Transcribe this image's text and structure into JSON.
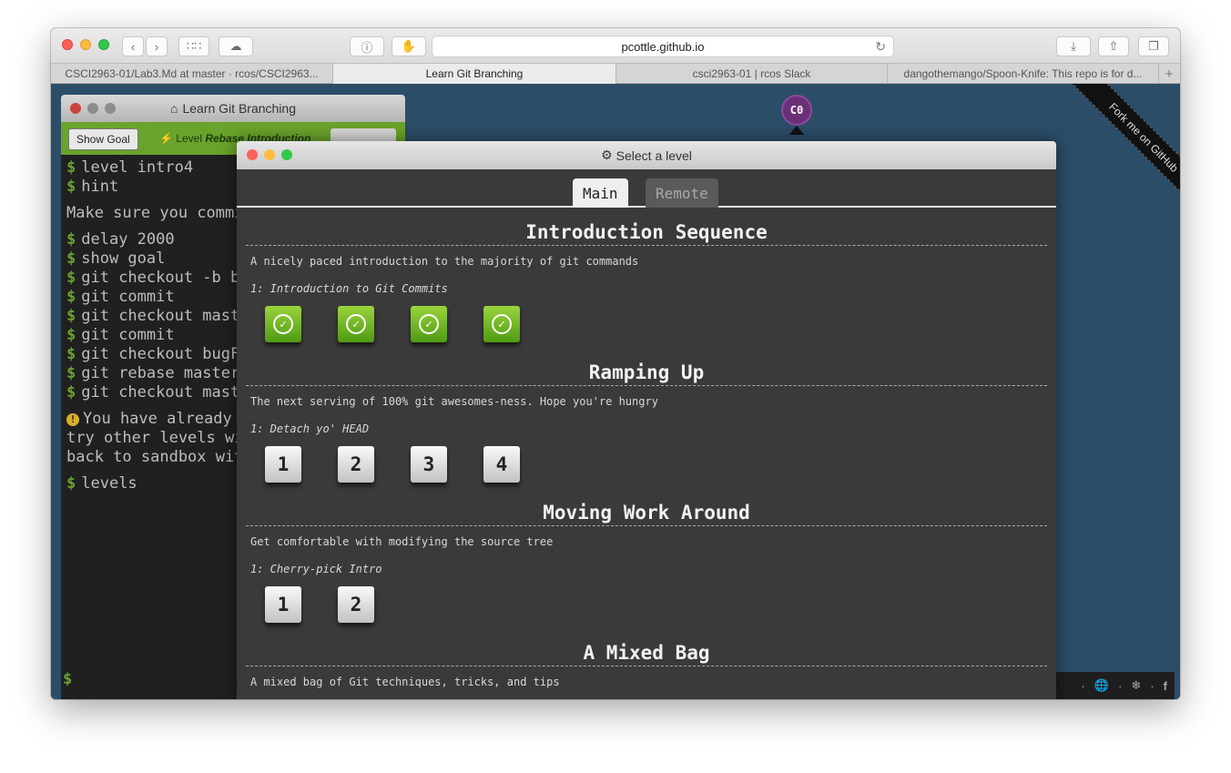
{
  "browser": {
    "url": "pcottle.github.io",
    "tabs": [
      "CSCI2963-01/Lab3.Md at master · rcos/CSCI2963...",
      "Learn Git Branching",
      "csci2963-01 | rcos Slack",
      "dangothemango/Spoon-Knife: This repo is for d..."
    ],
    "new_tab": "+"
  },
  "terminal": {
    "title": "Learn Git Branching",
    "show_goal": "Show Goal",
    "level_prefix": "Level",
    "level_name": "Rebase Introduction",
    "prompt_symbol": "$",
    "lines": [
      "level intro4",
      "hint",
      "Make sure you commit",
      "delay 2000",
      "show goal",
      "git checkout -b bu",
      "git commit",
      "git checkout maste",
      "git commit",
      "git checkout bugFi",
      "git rebase master",
      "git checkout maste",
      "You have already s",
      "try other levels wit",
      "back to sandbox with",
      "levels"
    ]
  },
  "graph": {
    "commit": "C0",
    "ribbon": "Fork me on GitHub"
  },
  "modal": {
    "title": "Select a level",
    "tabs": [
      "Main",
      "Remote"
    ],
    "sequences": [
      {
        "title": "Introduction Sequence",
        "desc": "A nicely paced introduction to the majority of git commands",
        "sub": "1: Introduction to Git Commits",
        "levels": [
          "",
          "",
          "",
          ""
        ]
      },
      {
        "title": "Ramping Up",
        "desc": "The next serving of 100% git awesomes-ness. Hope you're hungry",
        "sub": "1: Detach yo' HEAD",
        "levels": [
          "1",
          "2",
          "3",
          "4"
        ]
      },
      {
        "title": "Moving Work Around",
        "desc": "Get comfortable with modifying the source tree",
        "sub": "1: Cherry-pick Intro",
        "levels": [
          "1",
          "2"
        ]
      },
      {
        "title": "A Mixed Bag",
        "desc": "A mixed bag of Git techniques, tricks, and tips"
      }
    ]
  }
}
